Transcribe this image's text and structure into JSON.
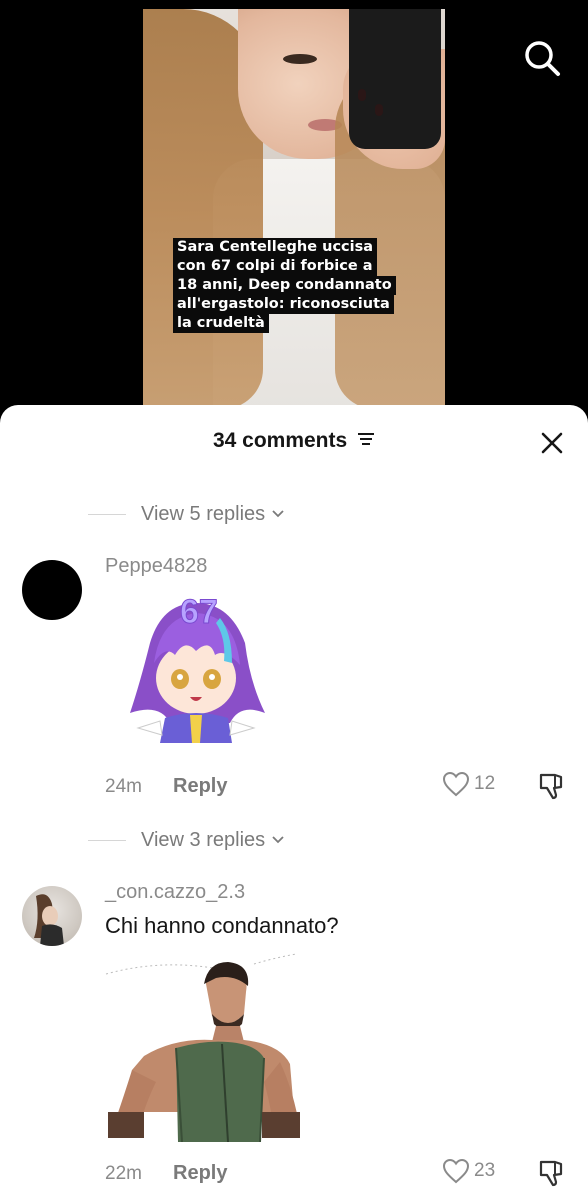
{
  "video": {
    "caption_lines": [
      "Sara Centelleghe uccisa",
      "con 67 colpi di forbice a",
      "18 anni, Deep condannato",
      "all'ergastolo: riconosciuta",
      "la crudeltà"
    ],
    "search_icon": "search-icon"
  },
  "comments_header": {
    "count_label": "34 comments",
    "sort_icon": "sort-icon",
    "close_icon": "close-icon"
  },
  "threads": [
    {
      "view_replies_label": "View 5 replies",
      "username": "Peppe4828",
      "text": "",
      "sticker": {
        "label": "67",
        "description_icon": "anime-sticker"
      },
      "time": "24m",
      "reply_label": "Reply",
      "likes": "12"
    },
    {
      "view_replies_label": "View 3 replies",
      "username": "_con.cazzo_2.3",
      "text": "Chi hanno condannato?",
      "sticker": {
        "description_icon": "man-sticker"
      },
      "time": "22m",
      "reply_label": "Reply",
      "likes": "23"
    }
  ],
  "colors": {
    "sheet_bg": "#ffffff",
    "muted_text": "#8a8a8a",
    "primary_text": "#161616"
  }
}
